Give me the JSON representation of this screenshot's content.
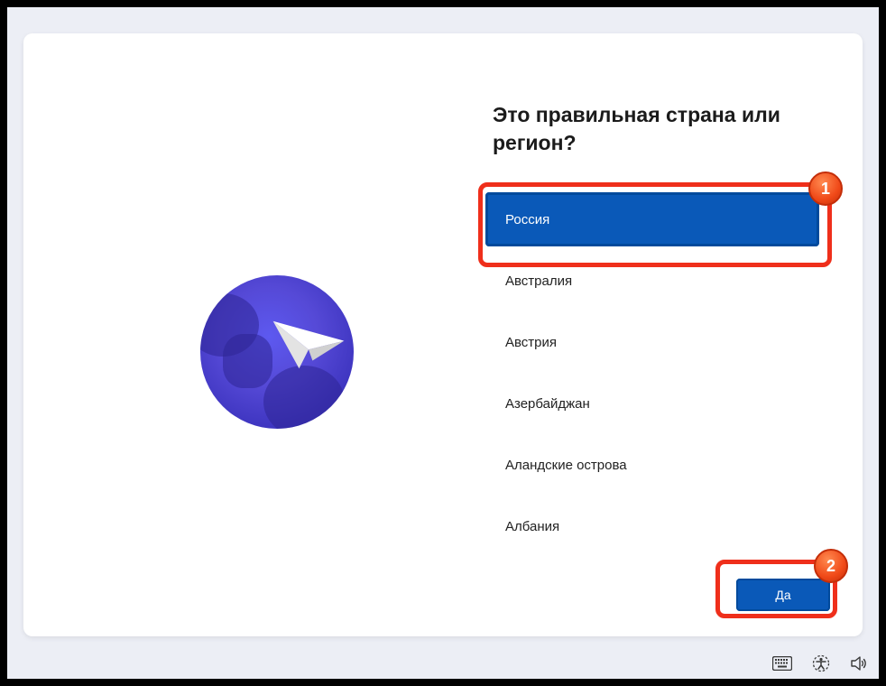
{
  "heading": "Это правильная страна или регион?",
  "countries": [
    {
      "name": "Россия",
      "selected": true
    },
    {
      "name": "Австралия",
      "selected": false
    },
    {
      "name": "Австрия",
      "selected": false
    },
    {
      "name": "Азербайджан",
      "selected": false
    },
    {
      "name": "Аландские острова",
      "selected": false
    },
    {
      "name": "Албания",
      "selected": false
    }
  ],
  "yes_button": "Да",
  "annotations": {
    "badge1": "1",
    "badge2": "2"
  },
  "tray_icons": {
    "keyboard": "keyboard-icon",
    "accessibility": "accessibility-icon",
    "sound": "sound-icon"
  }
}
